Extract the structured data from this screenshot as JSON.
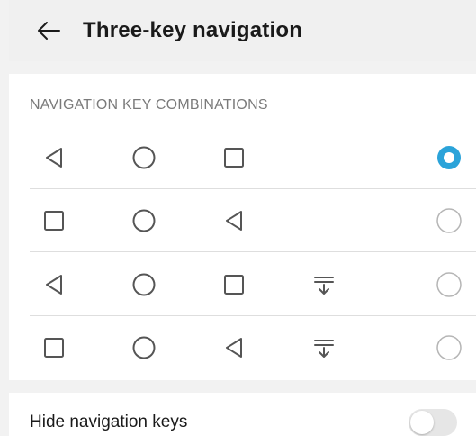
{
  "header": {
    "back_icon": "arrow-left-icon",
    "title": "Three-key navigation"
  },
  "section": {
    "title": "NAVIGATION KEY COMBINATIONS"
  },
  "combinations": [
    {
      "keys": [
        "back",
        "home",
        "recents"
      ],
      "selected": true
    },
    {
      "keys": [
        "recents",
        "home",
        "back"
      ],
      "selected": false
    },
    {
      "keys": [
        "back",
        "home",
        "recents",
        "notifications"
      ],
      "selected": false
    },
    {
      "keys": [
        "recents",
        "home",
        "back",
        "notifications"
      ],
      "selected": false
    }
  ],
  "hide_keys": {
    "label": "Hide navigation keys",
    "enabled": false
  },
  "colors": {
    "accent": "#2ba3d9",
    "icon": "#555555",
    "radio_off": "#b5b5b5"
  }
}
